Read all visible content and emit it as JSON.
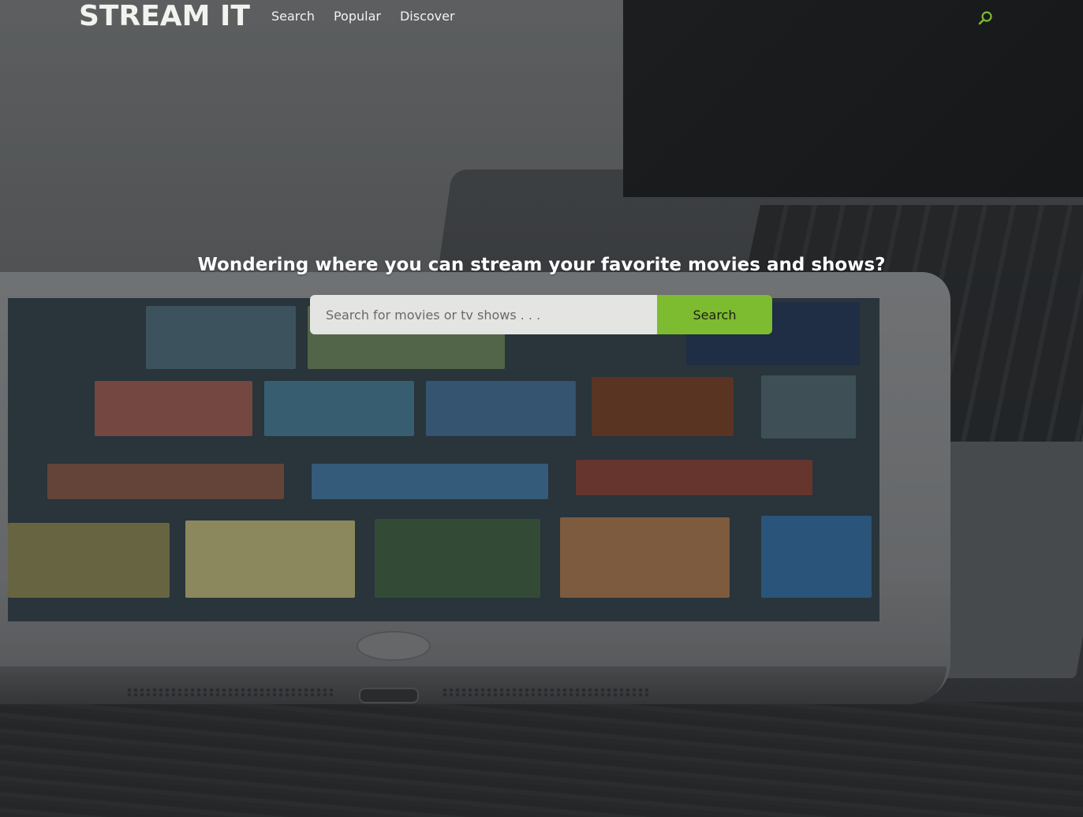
{
  "navbar": {
    "brand": "STREAM IT",
    "links": [
      "Search",
      "Popular",
      "Discover"
    ],
    "search_icon": "search-icon"
  },
  "hero": {
    "title": "Wondering where you can stream your favorite movies and shows?",
    "search": {
      "placeholder": "Search for movies or tv shows . . .",
      "value": "",
      "button_label": "Search"
    }
  },
  "colors": {
    "accent": "#7dbb30",
    "input_bg": "#e4e4e2",
    "text_light": "#ffffff"
  },
  "background": {
    "description_icon": "tablet-and-laptop-photo"
  }
}
